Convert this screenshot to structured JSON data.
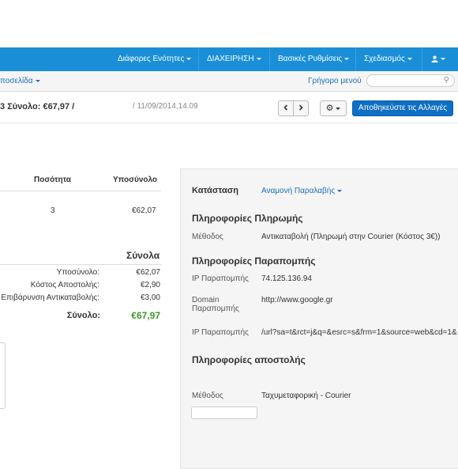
{
  "nav": {
    "items": [
      {
        "label": "Διάφορες Ενότητες"
      },
      {
        "label": "ΔΙΑΧΕΙΡΗΣΗ"
      },
      {
        "label": "Βασικές Ρυθμίσεις"
      },
      {
        "label": "Σχεδιασμός"
      }
    ],
    "user_icon": "user-icon"
  },
  "subnav": {
    "home_label": "ποσελίδα",
    "quick_menu_label": "Γρήγορο μενού",
    "search_placeholder": ""
  },
  "header": {
    "title_prefix": "3",
    "title": "Σύνολο: €67,97 /",
    "date": "/ 11/09/2014,14.09",
    "save_label": "Αποθηκεύστε τις Αλλαγές"
  },
  "items_table": {
    "columns": [
      "Ποσότητα",
      "Υποσύνολο"
    ],
    "rows": [
      {
        "quantity": "3",
        "subtotal": "€62,07"
      }
    ]
  },
  "totals": {
    "title": "Σύνολα",
    "rows": [
      {
        "label": "Υποσύνολο:",
        "value": "€62,07"
      },
      {
        "label": "Κόστος Αποστολής:",
        "value": "€2,90"
      },
      {
        "label": "Επιβάρυνση Αντικαταβολής:",
        "value": "€3,00"
      }
    ],
    "grand_label": "Σύνολο:",
    "grand_value": "€67,97",
    "grand_color": "#3a9a2a"
  },
  "panel": {
    "status_label": "Κατάσταση",
    "status_value": "Αναμονή Παραλαβής",
    "payment_title": "Πληροφορίες Πληρωμής",
    "payment_method_label": "Μέθοδος",
    "payment_method_value": "Αντικαταβολή (Πληρωμή στην Courier (Κόστος 3€))",
    "referral_title": "Πληροφορίες Παραπομπής",
    "referral_ip_label": "IP Παραπομπής",
    "referral_ip_value": "74.125.136.94",
    "referral_domain_label_1": "Domain",
    "referral_domain_label_2": "Παραπομπής",
    "referral_domain_value": "http://www.google.gr",
    "referral_ip2_label": "IP Παραπομπής",
    "referral_ip2_value": "/url?sa=t&rct=j&q=&esrc=s&frm=1&source=web&cd=1&",
    "shipping_title": "Πληροφορίες αποστολής",
    "shipping_method_label": "Μέθοδος",
    "shipping_method_value": "Ταχυμεταφορική - Courier"
  }
}
